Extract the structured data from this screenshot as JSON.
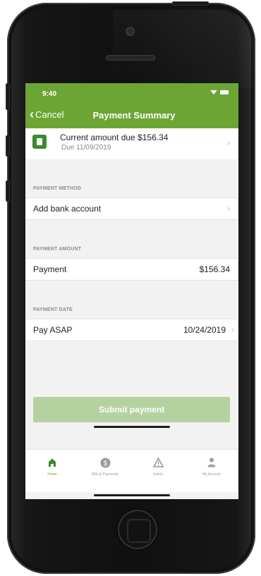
{
  "status_bar": {
    "time": "9:40"
  },
  "nav": {
    "cancel_label": "Cancel",
    "title": "Payment Summary"
  },
  "amount_due": {
    "title": "Current amount due $156.34",
    "subtitle": "Due 11/09/2019"
  },
  "payment_method": {
    "section_label": "PAYMENT METHOD",
    "row_label": "Add bank account"
  },
  "payment_amount": {
    "section_label": "PAYMENT AMOUNT",
    "row_label": "Payment",
    "value": "$156.34"
  },
  "payment_date": {
    "section_label": "PAYMENT DATE",
    "row_label": "Pay ASAP",
    "value": "10/24/2019"
  },
  "submit": {
    "label": "Submit payment"
  },
  "tabs": [
    {
      "label": "Home",
      "icon": "home-icon",
      "active": true
    },
    {
      "label": "Bills & Payments",
      "icon": "dollar-icon",
      "active": false
    },
    {
      "label": "Safety",
      "icon": "warning-icon",
      "active": false
    },
    {
      "label": "My Account",
      "icon": "person-icon",
      "active": false
    }
  ],
  "colors": {
    "brand_green": "#6da535",
    "submit_disabled": "#b4d2a0",
    "bill_icon": "#3a8a2e"
  }
}
